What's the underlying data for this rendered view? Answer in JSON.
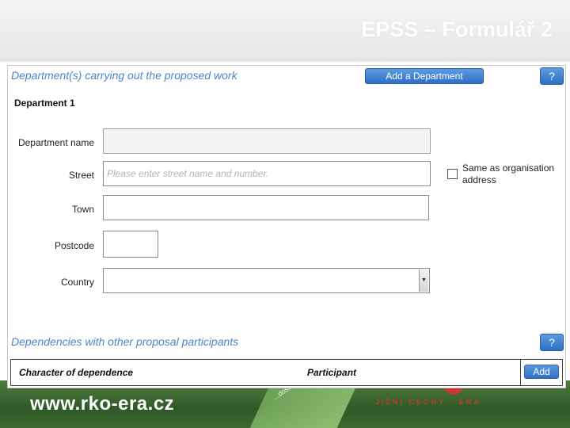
{
  "slide": {
    "title": "EPSS – Formulář 2",
    "footer_url": "www.rko-era.cz",
    "footer_region": "JIŽNÍ ČECHY - ERA",
    "footer_decor_text": "...dostor..."
  },
  "form": {
    "departments_section_title": "Department(s) carrying out the proposed work",
    "add_department_label": "Add a Department",
    "help_label": "?",
    "department_heading": "Department 1",
    "fields": {
      "name_label": "Department name",
      "name_value": "",
      "street_label": "Street",
      "street_placeholder": "Please enter street name and number.",
      "town_label": "Town",
      "town_value": "",
      "postcode_label": "Postcode",
      "postcode_value": "",
      "country_label": "Country",
      "country_value": ""
    },
    "same_address": {
      "label": "Same as organisation address",
      "checked": false
    },
    "dependencies_section_title": "Dependencies with other proposal participants",
    "dependencies_table": {
      "columns": [
        "Character of dependence",
        "Participant"
      ],
      "add_label": "Add"
    }
  },
  "colors": {
    "accent_blue": "#2f6fc5",
    "section_title": "#4a86c5",
    "footer_green": "#3b6a2f",
    "footer_red": "#c33a2f"
  }
}
